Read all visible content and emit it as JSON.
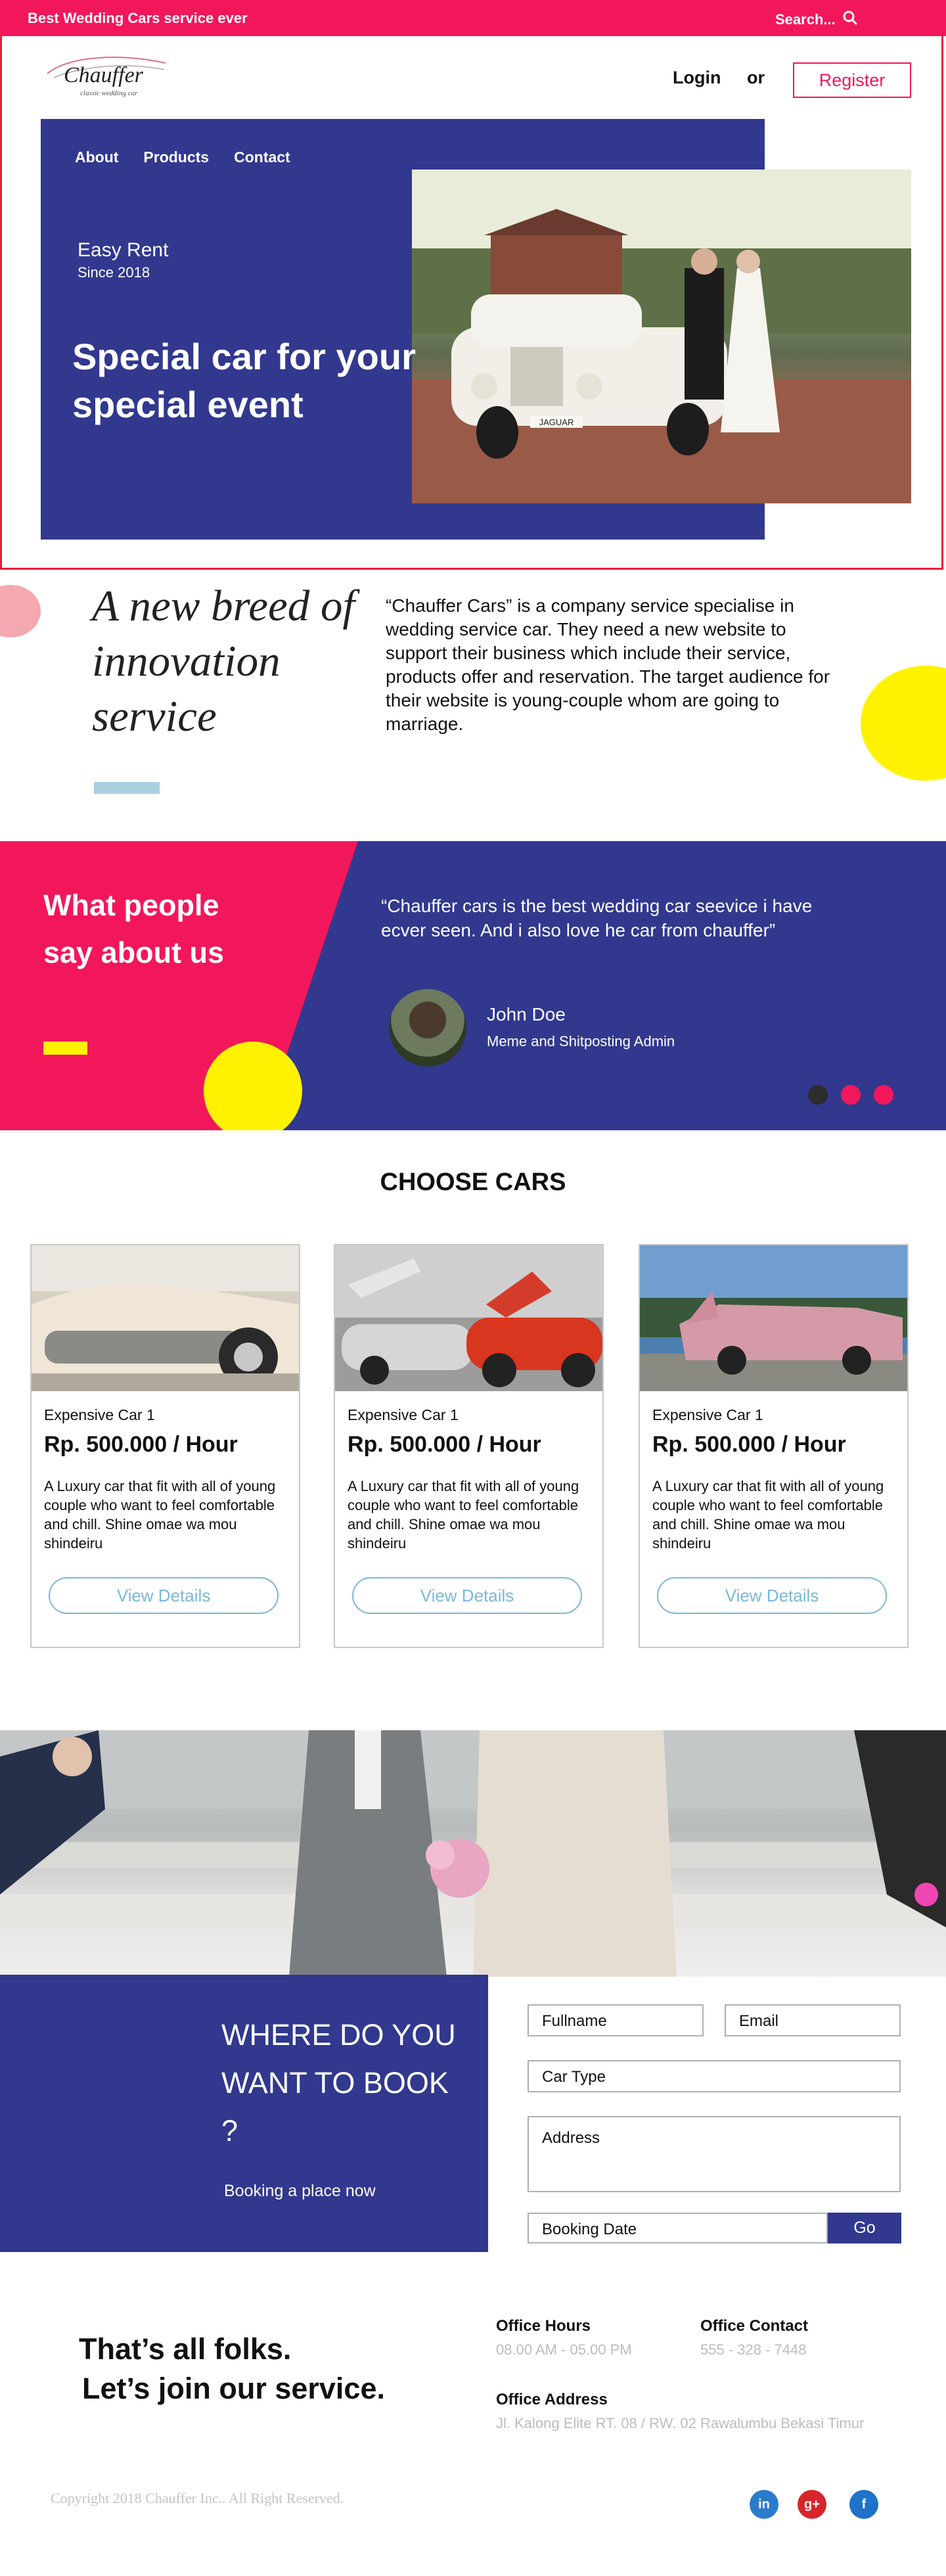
{
  "topbar": {
    "brand": "Best Wedding Cars service ever",
    "search_label": "Search...",
    "search_icon": "search-icon"
  },
  "header": {
    "logo_name": "Chauffer",
    "logo_tagline": "classic wedding car",
    "login": "Login",
    "or": "or",
    "register": "Register"
  },
  "nav": [
    {
      "label": "About"
    },
    {
      "label": "Products"
    },
    {
      "label": "Contact"
    }
  ],
  "hero": {
    "eyebrow": "Easy Rent",
    "since": "Since 2018",
    "headline": "Special car for your special event",
    "plate": "JAGUAR"
  },
  "about": {
    "title": "A new breed of innovation service",
    "text": "“Chauffer Cars” is a company service specialise in wedding service car. They need a new website to support their business which include their service, products offer and reservation. The target audience for their website is young-couple whom are going to marriage."
  },
  "testimonial": {
    "heading": "What people say about us",
    "quote": "“Chauffer cars is the best wedding car seevice i have ecver seen. And i also love he car from chauffer”",
    "name": "John Doe",
    "role": "Meme and Shitposting Admin",
    "dot_colors": [
      "#2d2d2d",
      "#f2175b",
      "#f2175b"
    ]
  },
  "cars": {
    "title": "CHOOSE CARS",
    "items": [
      {
        "name": "Expensive Car 1",
        "price": "Rp. 500.000 / Hour",
        "desc": "A Luxury car that fit with all of young couple who want to feel comfortable and chill. Shine omae wa mou shindeiru",
        "button": "View Details"
      },
      {
        "name": "Expensive Car 1",
        "price": "Rp. 500.000 / Hour",
        "desc": "A Luxury car that fit with all of young couple who want to feel comfortable and chill. Shine omae wa mou shindeiru",
        "button": "View Details"
      },
      {
        "name": "Expensive Car 1",
        "price": "Rp. 500.000 / Hour",
        "desc": "A Luxury car that fit with all of young couple who want to feel comfortable and chill. Shine omae wa mou shindeiru",
        "button": "View Details"
      }
    ]
  },
  "booking": {
    "title": "WHERE DO YOU WANT TO BOOK ?",
    "subtitle": "Booking a place now",
    "fullname": "Fullname",
    "email": "Email",
    "car_type": "Car Type",
    "address": "Address",
    "booking_date": "Booking Date",
    "go": "Go"
  },
  "footer": {
    "tagline_line1": "That’s all folks.",
    "tagline_line2": "Let’s join our service.",
    "hours_label": "Office Hours",
    "hours_value": "08.00 AM - 05.00 PM",
    "contact_label": "Office Contact",
    "contact_value": "555 - 328 - 7448",
    "address_label": "Office Address",
    "address_value": "Jl. Kalong Elite RT. 08 / RW. 02 Rawalumbu Bekasi Timur",
    "copyright": "Copyright 2018 Chauffer Inc.. All Right Reserved.",
    "social": [
      {
        "icon": "linkedin-icon",
        "glyph": "in",
        "color": "#2b7bcc"
      },
      {
        "icon": "google-plus-icon",
        "glyph": "g+",
        "color": "#d7262b"
      },
      {
        "icon": "facebook-icon",
        "glyph": "f",
        "color": "#1e72c9"
      }
    ]
  },
  "colors": {
    "accent": "#f2175b",
    "navy": "#31388e",
    "yellow": "#fff200",
    "link": "#7bb8d8"
  }
}
